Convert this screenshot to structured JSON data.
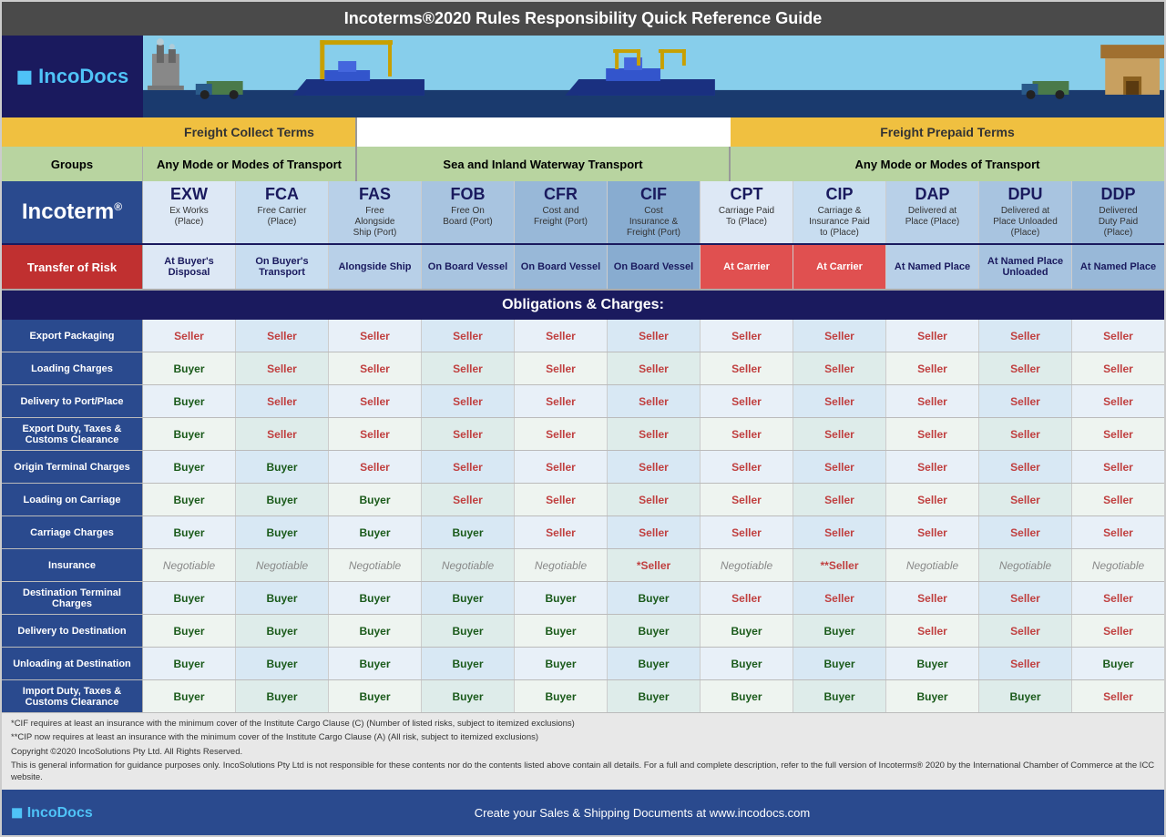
{
  "title": "Incoterms®2020 Rules Responsibility Quick Reference Guide",
  "header": {
    "logo": "IncoDocs",
    "logo_prefix": "Inco",
    "logo_suffix": "Docs"
  },
  "freight": {
    "collect": "Freight Collect Terms",
    "prepaid": "Freight Prepaid Terms"
  },
  "transport": {
    "groups": "Groups",
    "any_mode_1": "Any Mode or Modes of Transport",
    "sea_inland": "Sea and Inland Waterway Transport",
    "any_mode_2": "Any Mode or Modes of Transport"
  },
  "incoterm_label": "Incoterm®",
  "columns": [
    {
      "code": "EXW",
      "desc": "Ex Works\n(Place)",
      "class": "col-exw"
    },
    {
      "code": "FCA",
      "desc": "Free Carrier\n(Place)",
      "class": "col-fca"
    },
    {
      "code": "FAS",
      "desc": "Free\nAlongside\nShip (Port)",
      "class": "col-fas"
    },
    {
      "code": "FOB",
      "desc": "Free On\nBoard (Port)",
      "class": "col-fob"
    },
    {
      "code": "CFR",
      "desc": "Cost and\nFreight (Port)",
      "class": "col-cfr"
    },
    {
      "code": "CIF",
      "desc": "Cost\nInsurance &\nFreight (Port)",
      "class": "col-cif"
    },
    {
      "code": "CPT",
      "desc": "Carriage Paid\nTo (Place)",
      "class": "col-cpt"
    },
    {
      "code": "CIP",
      "desc": "Carriage &\nInsurance Paid\nto (Place)",
      "class": "col-cip"
    },
    {
      "code": "DAP",
      "desc": "Delivered at\nPlace (Place)",
      "class": "col-dap"
    },
    {
      "code": "DPU",
      "desc": "Delivered at\nPlace Unloaded\n(Place)",
      "class": "col-dpu"
    },
    {
      "code": "DDP",
      "desc": "Delivered\nDuty Paid\n(Place)",
      "class": "col-ddp"
    }
  ],
  "risk": {
    "label": "Transfer of Risk",
    "values": [
      "At Buyer's Disposal",
      "On Buyer's Transport",
      "Alongside Ship",
      "On Board Vessel",
      "On Board Vessel",
      "On Board Vessel",
      "At Carrier",
      "At Carrier",
      "At Named Place",
      "At Named Place Unloaded",
      "At Named Place"
    ],
    "red_indices": [
      6,
      7
    ]
  },
  "obligations_header": "Obligations & Charges:",
  "rows": [
    {
      "label": "Export Packaging",
      "values": [
        "Seller",
        "Seller",
        "Seller",
        "Seller",
        "Seller",
        "Seller",
        "Seller",
        "Seller",
        "Seller",
        "Seller",
        "Seller"
      ],
      "types": [
        "seller",
        "seller",
        "seller",
        "seller",
        "seller",
        "seller",
        "seller",
        "seller",
        "seller",
        "seller",
        "seller"
      ]
    },
    {
      "label": "Loading Charges",
      "values": [
        "Buyer",
        "Seller",
        "Seller",
        "Seller",
        "Seller",
        "Seller",
        "Seller",
        "Seller",
        "Seller",
        "Seller",
        "Seller"
      ],
      "types": [
        "buyer",
        "seller",
        "seller",
        "seller",
        "seller",
        "seller",
        "seller",
        "seller",
        "seller",
        "seller",
        "seller"
      ]
    },
    {
      "label": "Delivery to Port/Place",
      "values": [
        "Buyer",
        "Seller",
        "Seller",
        "Seller",
        "Seller",
        "Seller",
        "Seller",
        "Seller",
        "Seller",
        "Seller",
        "Seller"
      ],
      "types": [
        "buyer",
        "seller",
        "seller",
        "seller",
        "seller",
        "seller",
        "seller",
        "seller",
        "seller",
        "seller",
        "seller"
      ]
    },
    {
      "label": "Export Duty, Taxes & Customs Clearance",
      "values": [
        "Buyer",
        "Seller",
        "Seller",
        "Seller",
        "Seller",
        "Seller",
        "Seller",
        "Seller",
        "Seller",
        "Seller",
        "Seller"
      ],
      "types": [
        "buyer",
        "seller",
        "seller",
        "seller",
        "seller",
        "seller",
        "seller",
        "seller",
        "seller",
        "seller",
        "seller"
      ]
    },
    {
      "label": "Origin Terminal Charges",
      "values": [
        "Buyer",
        "Buyer",
        "Seller",
        "Seller",
        "Seller",
        "Seller",
        "Seller",
        "Seller",
        "Seller",
        "Seller",
        "Seller"
      ],
      "types": [
        "buyer",
        "buyer",
        "seller",
        "seller",
        "seller",
        "seller",
        "seller",
        "seller",
        "seller",
        "seller",
        "seller"
      ]
    },
    {
      "label": "Loading on Carriage",
      "values": [
        "Buyer",
        "Buyer",
        "Buyer",
        "Seller",
        "Seller",
        "Seller",
        "Seller",
        "Seller",
        "Seller",
        "Seller",
        "Seller"
      ],
      "types": [
        "buyer",
        "buyer",
        "buyer",
        "seller",
        "seller",
        "seller",
        "seller",
        "seller",
        "seller",
        "seller",
        "seller"
      ]
    },
    {
      "label": "Carriage Charges",
      "values": [
        "Buyer",
        "Buyer",
        "Buyer",
        "Buyer",
        "Seller",
        "Seller",
        "Seller",
        "Seller",
        "Seller",
        "Seller",
        "Seller"
      ],
      "types": [
        "buyer",
        "buyer",
        "buyer",
        "buyer",
        "seller",
        "seller",
        "seller",
        "seller",
        "seller",
        "seller",
        "seller"
      ]
    },
    {
      "label": "Insurance",
      "values": [
        "Negotiable",
        "Negotiable",
        "Negotiable",
        "Negotiable",
        "Negotiable",
        "*Seller",
        "Negotiable",
        "**Seller",
        "Negotiable",
        "Negotiable",
        "Negotiable"
      ],
      "types": [
        "negotiable",
        "negotiable",
        "negotiable",
        "negotiable",
        "negotiable",
        "seller",
        "negotiable",
        "seller",
        "negotiable",
        "negotiable",
        "negotiable"
      ]
    },
    {
      "label": "Destination Terminal Charges",
      "values": [
        "Buyer",
        "Buyer",
        "Buyer",
        "Buyer",
        "Buyer",
        "Buyer",
        "Seller",
        "Seller",
        "Seller",
        "Seller",
        "Seller"
      ],
      "types": [
        "buyer",
        "buyer",
        "buyer",
        "buyer",
        "buyer",
        "buyer",
        "seller",
        "seller",
        "seller",
        "seller",
        "seller"
      ]
    },
    {
      "label": "Delivery to Destination",
      "values": [
        "Buyer",
        "Buyer",
        "Buyer",
        "Buyer",
        "Buyer",
        "Buyer",
        "Buyer",
        "Buyer",
        "Seller",
        "Seller",
        "Seller"
      ],
      "types": [
        "buyer",
        "buyer",
        "buyer",
        "buyer",
        "buyer",
        "buyer",
        "buyer",
        "buyer",
        "seller",
        "seller",
        "seller"
      ]
    },
    {
      "label": "Unloading at Destination",
      "values": [
        "Buyer",
        "Buyer",
        "Buyer",
        "Buyer",
        "Buyer",
        "Buyer",
        "Buyer",
        "Buyer",
        "Buyer",
        "Seller",
        "Buyer"
      ],
      "types": [
        "buyer",
        "buyer",
        "buyer",
        "buyer",
        "buyer",
        "buyer",
        "buyer",
        "buyer",
        "buyer",
        "seller",
        "buyer"
      ]
    },
    {
      "label": "Import Duty, Taxes & Customs Clearance",
      "values": [
        "Buyer",
        "Buyer",
        "Buyer",
        "Buyer",
        "Buyer",
        "Buyer",
        "Buyer",
        "Buyer",
        "Buyer",
        "Buyer",
        "Seller"
      ],
      "types": [
        "buyer",
        "buyer",
        "buyer",
        "buyer",
        "buyer",
        "buyer",
        "buyer",
        "buyer",
        "buyer",
        "buyer",
        "seller"
      ]
    }
  ],
  "footer": {
    "logo_prefix": "Inco",
    "logo_suffix": "Docs",
    "text": "Create your Sales & Shipping Documents at www.incodocs.com",
    "notes": [
      "*CIF requires at least an insurance with the minimum cover of the Institute Cargo Clause (C) (Number of listed risks, subject to itemized exclusions)",
      "**CIP now requires at least an insurance with the minimum cover of the Institute Cargo Clause (A) (All risk, subject to itemized exclusions)",
      "Copyright ©2020 IncoSolutions Pty Ltd. All Rights Reserved.",
      "This is general information for guidance purposes only. IncoSolutions Pty Ltd is not responsible for these contents nor do the contents listed above contain all details. For a full and complete description, refer to the full version of Incoterms® 2020 by the International Chamber of Commerce at the ICC website."
    ]
  }
}
